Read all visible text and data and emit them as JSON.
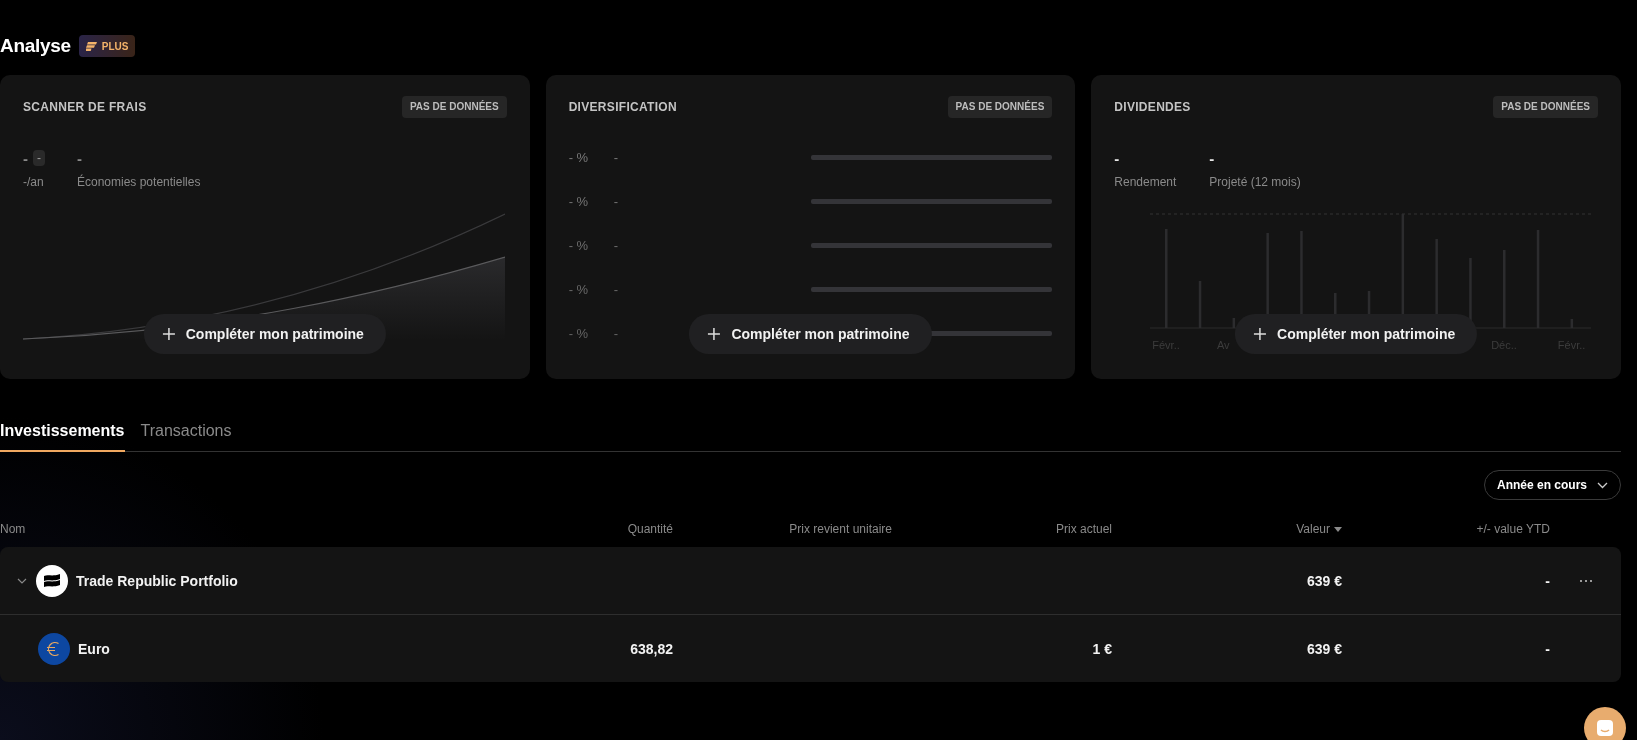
{
  "header": {
    "title": "Analyse",
    "badge": "PLUS"
  },
  "cards": [
    {
      "kind": "fees",
      "title": "SCANNER DE FRAIS",
      "status": "PAS DE DONNÉES",
      "stats": [
        {
          "value": "-",
          "chip": "-",
          "label": "-/an"
        },
        {
          "value": "-",
          "label": "Économies potentielles"
        }
      ],
      "action": "Compléter mon patrimoine"
    },
    {
      "kind": "diversification",
      "title": "DIVERSIFICATION",
      "status": "PAS DE DONNÉES",
      "rows": [
        {
          "percent": "- %",
          "label": "-"
        },
        {
          "percent": "- %",
          "label": "-"
        },
        {
          "percent": "- %",
          "label": "-"
        },
        {
          "percent": "- %",
          "label": "-"
        },
        {
          "percent": "- %",
          "label": "-"
        }
      ],
      "action": "Compléter mon patrimoine"
    },
    {
      "kind": "dividends",
      "title": "DIVIDENDES",
      "status": "PAS DE DONNÉES",
      "stats": [
        {
          "value": "-",
          "label": "Rendement"
        },
        {
          "value": "-",
          "label": "Projeté (12 mois)"
        }
      ],
      "axis_labels": [
        "Févr..",
        "Av",
        "Déc..",
        "Févr.."
      ],
      "action": "Compléter mon patrimoine"
    }
  ],
  "tabs": [
    {
      "label": "Investissements",
      "selected": true
    },
    {
      "label": "Transactions",
      "selected": false
    }
  ],
  "period_select": {
    "value": "Année en cours"
  },
  "table": {
    "columns": [
      {
        "label": "Nom",
        "sorted": false
      },
      {
        "label": "Quantité",
        "sorted": false
      },
      {
        "label": "Prix revient unitaire",
        "sorted": false
      },
      {
        "label": "Prix actuel",
        "sorted": false
      },
      {
        "label": "Valeur",
        "sorted": true
      },
      {
        "label": "+/- value YTD",
        "sorted": false
      }
    ],
    "rows": [
      {
        "kind": "group",
        "expanded": true,
        "name": "Trade Republic Portfolio",
        "value": "639 €",
        "ytd": "-"
      },
      {
        "kind": "asset",
        "name": "Euro",
        "quantity": "638,82",
        "price": "1 €",
        "value": "639 €",
        "ytd": "-"
      }
    ]
  }
}
